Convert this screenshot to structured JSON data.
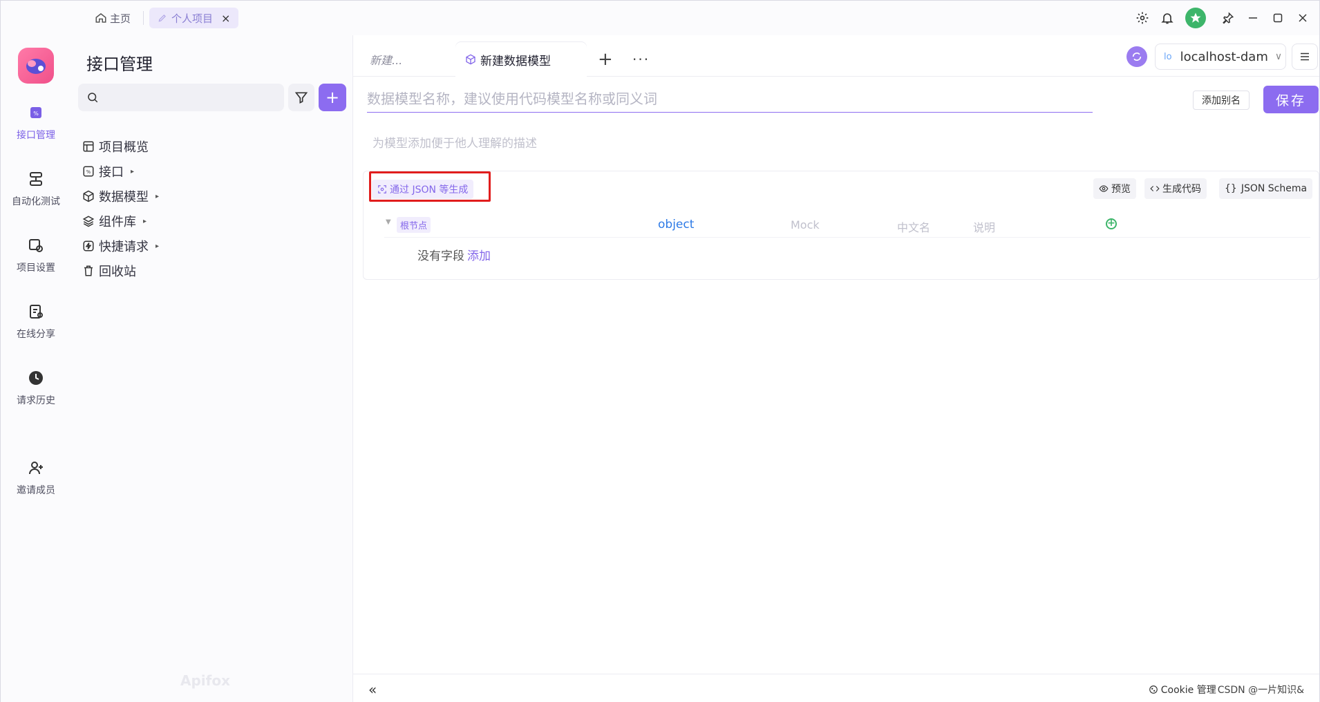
{
  "titlebar": {
    "home_label": "主页",
    "project_label": "个人项目",
    "close": "×"
  },
  "rail": {
    "items": [
      {
        "label": "接口管理",
        "icon": "api-icon",
        "active": true
      },
      {
        "label": "自动化测试",
        "icon": "automation-icon",
        "active": false
      },
      {
        "label": "项目设置",
        "icon": "project-settings-icon",
        "active": false
      },
      {
        "label": "在线分享",
        "icon": "share-icon",
        "active": false
      },
      {
        "label": "请求历史",
        "icon": "history-icon",
        "active": false
      },
      {
        "label": "邀请成员",
        "icon": "invite-member-icon",
        "active": false
      }
    ]
  },
  "sidebar": {
    "title": "接口管理",
    "search_placeholder": "",
    "add": "+",
    "tree": [
      {
        "label": "项目概览",
        "icon": "overview-icon",
        "caret": ""
      },
      {
        "label": "接口",
        "icon": "api-box-icon",
        "caret": "▸"
      },
      {
        "label": "数据模型",
        "icon": "cube-icon",
        "caret": "▸"
      },
      {
        "label": "组件库",
        "icon": "layers-icon",
        "caret": "▸"
      },
      {
        "label": "快捷请求",
        "icon": "lightning-icon",
        "caret": "▸"
      },
      {
        "label": "回收站",
        "icon": "trash-icon",
        "caret": ""
      }
    ],
    "watermark": "Apifox"
  },
  "tabs": {
    "draft_label": "新建...",
    "active_label": "新建数据模型",
    "plus": "+",
    "more": "···"
  },
  "env": {
    "badge": "lo",
    "name": "localhost-dam",
    "chevron": "∨"
  },
  "editor": {
    "name_placeholder": "数据模型名称，建议使用代码模型名称或同义词",
    "alias_label": "添加别名",
    "save_label": "保存",
    "desc_placeholder": "为模型添加便于他人理解的描述"
  },
  "schema": {
    "gen_json_label": "通过 JSON 等生成",
    "preview_label": "预览",
    "gen_code_label": "生成代码",
    "json_schema_label": "JSON Schema",
    "root_tag": "根节点",
    "root_type": "object",
    "mock_placeholder": "Mock",
    "cn_name_placeholder": "中文名",
    "desc_placeholder": "说明",
    "no_fields_text": "没有字段",
    "add_link": "添加"
  },
  "bottom": {
    "collapse": "«",
    "cookie_label": "Cookie 管理",
    "watermark": "CSDN @一片知识&"
  },
  "colors": {
    "accent": "#8c6cf0",
    "highlight_box": "#e11d1d",
    "type_blue": "#2d7ae6",
    "add_green": "#3db56a"
  }
}
